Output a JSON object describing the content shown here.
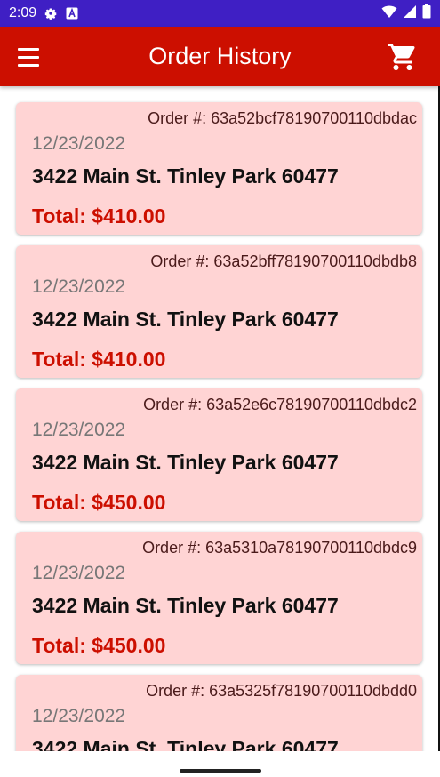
{
  "status_bar": {
    "time": "2:09",
    "icons": [
      "gear-icon",
      "a-badge-icon",
      "wifi-icon",
      "signal-icon",
      "battery-icon"
    ]
  },
  "app_bar": {
    "title": "Order History",
    "menu_icon": "hamburger-menu-icon",
    "cart_icon": "shopping-cart-icon"
  },
  "colors": {
    "status_bar": "#3f1fc4",
    "app_bar": "#cc0f00",
    "card_background": "#ffd4d4",
    "total_text": "#cc0f00"
  },
  "orders": [
    {
      "order_number": "Order #: 63a52bcf78190700110dbdac",
      "date": "12/23/2022",
      "address": "3422 Main St. Tinley Park 60477",
      "total": "Total: $410.00"
    },
    {
      "order_number": "Order #: 63a52bff78190700110dbdb8",
      "date": "12/23/2022",
      "address": "3422 Main St. Tinley Park 60477",
      "total": "Total: $410.00"
    },
    {
      "order_number": "Order #: 63a52e6c78190700110dbdc2",
      "date": "12/23/2022",
      "address": "3422 Main St. Tinley Park 60477",
      "total": "Total: $450.00"
    },
    {
      "order_number": "Order #: 63a5310a78190700110dbdc9",
      "date": "12/23/2022",
      "address": "3422 Main St. Tinley Park 60477",
      "total": "Total: $450.00"
    },
    {
      "order_number": "Order #: 63a5325f78190700110dbdd0",
      "date": "12/23/2022",
      "address": "3422 Main St. Tinley Park 60477",
      "total": ""
    }
  ]
}
